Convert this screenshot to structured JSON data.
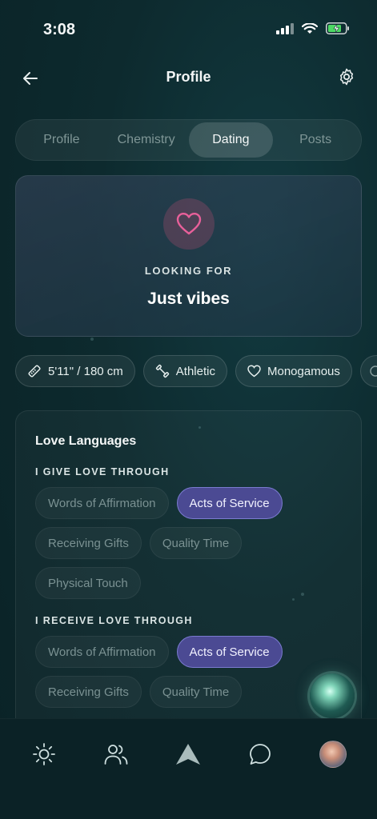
{
  "status_bar": {
    "time": "3:08"
  },
  "header": {
    "title": "Profile"
  },
  "tabs": [
    {
      "label": "Profile",
      "active": false
    },
    {
      "label": "Chemistry",
      "active": false
    },
    {
      "label": "Dating",
      "active": true
    },
    {
      "label": "Posts",
      "active": false
    }
  ],
  "looking_for": {
    "label": "LOOKING FOR",
    "value": "Just vibes"
  },
  "attribute_chips": [
    {
      "icon": "ruler-icon",
      "label": "5'11\" / 180 cm"
    },
    {
      "icon": "dumbbell-icon",
      "label": "Athletic"
    },
    {
      "icon": "heart-outline-icon",
      "label": "Monogamous"
    }
  ],
  "love_languages": {
    "title": "Love Languages",
    "give": {
      "label": "I GIVE LOVE THROUGH",
      "options": [
        "Words of Affirmation",
        "Acts of Service",
        "Receiving Gifts",
        "Quality Time",
        "Physical Touch"
      ],
      "selected": "Acts of Service"
    },
    "receive": {
      "label": "I RECEIVE LOVE THROUGH",
      "options": [
        "Words of Affirmation",
        "Acts of Service",
        "Receiving Gifts",
        "Quality Time"
      ],
      "selected": "Acts of Service"
    }
  },
  "bottom_nav": [
    {
      "icon": "sun-icon"
    },
    {
      "icon": "people-icon"
    },
    {
      "icon": "arrow-logo-icon"
    },
    {
      "icon": "chat-bubble-icon"
    },
    {
      "icon": "avatar"
    }
  ],
  "colors": {
    "background": "#0d2a2e",
    "selected_pill": "#4b4a93",
    "heart_accent": "#e8609a"
  }
}
